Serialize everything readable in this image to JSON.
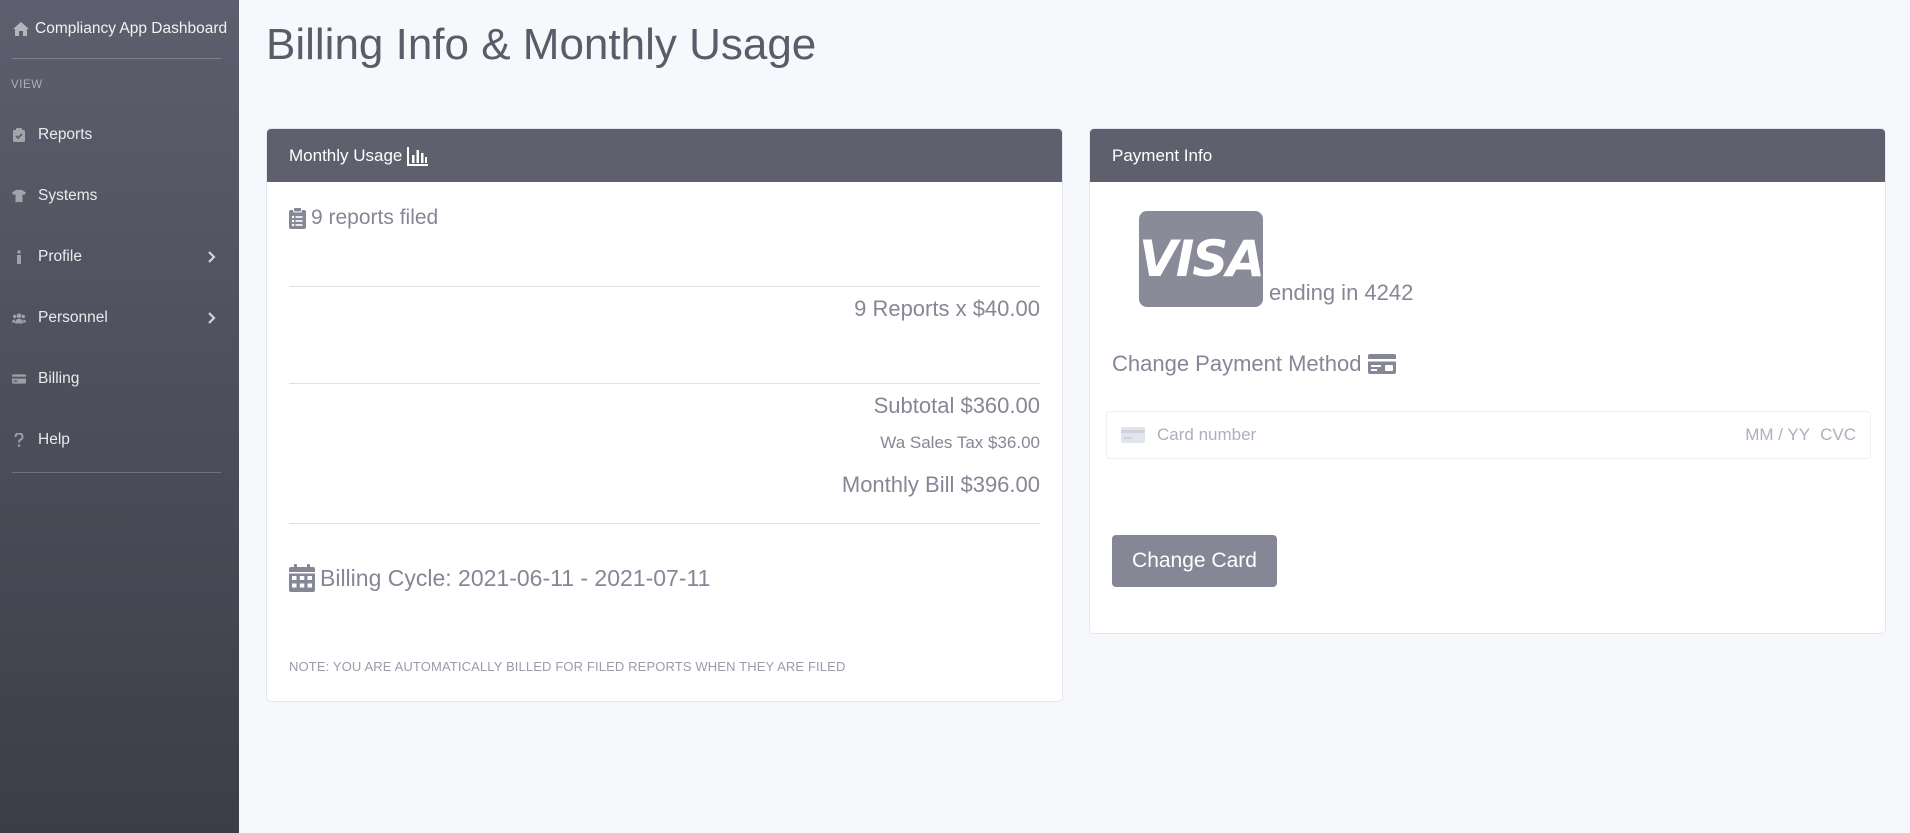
{
  "sidebar": {
    "brand": "Compliancy App Dashboard",
    "section_heading": "VIEW",
    "items": [
      {
        "label": "Reports",
        "icon": "clipboard-check-icon",
        "has_chevron": false
      },
      {
        "label": "Systems",
        "icon": "tshirt-icon",
        "has_chevron": false
      },
      {
        "label": "Profile",
        "icon": "info-icon",
        "has_chevron": true
      },
      {
        "label": "Personnel",
        "icon": "users-icon",
        "has_chevron": true
      },
      {
        "label": "Billing",
        "icon": "credit-card-icon",
        "has_chevron": false
      },
      {
        "label": "Help",
        "icon": "question-icon",
        "has_chevron": false
      }
    ]
  },
  "page": {
    "title": "Billing Info & Monthly Usage"
  },
  "usage": {
    "header": "Monthly Usage",
    "reports_filed": "9 reports filed",
    "line_item": "9 Reports x $40.00",
    "subtotal": "Subtotal $360.00",
    "tax": "Wa Sales Tax $36.00",
    "monthly_bill": "Monthly Bill $396.00",
    "billing_cycle": "Billing Cycle: 2021-06-11 - 2021-07-11",
    "note": "NOTE: YOU ARE AUTOMATICALLY BILLED FOR FILED REPORTS WHEN THEY ARE FILED"
  },
  "payment": {
    "header": "Payment Info",
    "card_brand": "VISA",
    "ending": "ending in 4242",
    "change_method": "Change Payment Method",
    "card_number_placeholder": "Card number",
    "expiry_placeholder": "MM / YY",
    "cvc_placeholder": "CVC",
    "change_button": "Change Card"
  },
  "colors": {
    "sidebar_top": "#5d5f6e",
    "sidebar_bottom": "#3c3d48",
    "card_header": "#5e606e",
    "button": "#858796",
    "background": "#f7f8fc"
  }
}
